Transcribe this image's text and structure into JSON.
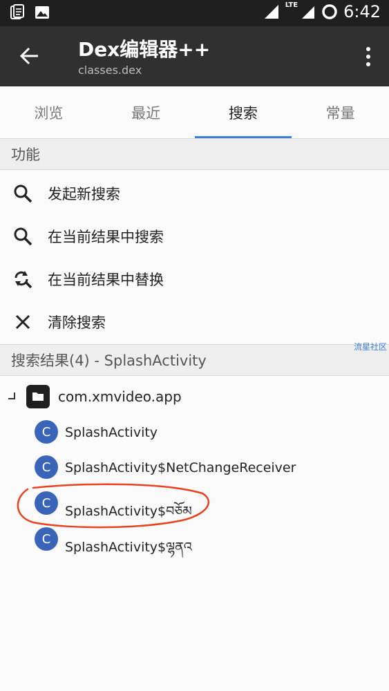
{
  "status_bar": {
    "network": "LTE",
    "time": "6:42"
  },
  "app_bar": {
    "title": "Dex编辑器++",
    "subtitle": "classes.dex"
  },
  "tabs": [
    {
      "label": "浏览"
    },
    {
      "label": "最近"
    },
    {
      "label": "搜索",
      "active": true
    },
    {
      "label": "常量"
    }
  ],
  "functions": {
    "header": "功能",
    "items": [
      {
        "label": "发起新搜索",
        "icon": "search-icon"
      },
      {
        "label": "在当前结果中搜索",
        "icon": "search-icon"
      },
      {
        "label": "在当前结果中替换",
        "icon": "search-replace-icon"
      },
      {
        "label": "清除搜索",
        "icon": "close-icon"
      }
    ]
  },
  "results": {
    "header": "搜索结果(4) - SplashActivity",
    "package": "com.xmvideo.app",
    "class_icon_letter": "C",
    "classes": [
      "SplashActivity",
      "SplashActivity$NetChangeReceiver",
      "SplashActivity$བཅོམ",
      "SplashActivity$ལྷནའ"
    ]
  },
  "watermark": "流星社区",
  "colors": {
    "accent": "#3d7fd9",
    "app_bar": "#303030",
    "class_icon": "#3a64b7",
    "annotation": "#e8431e"
  }
}
